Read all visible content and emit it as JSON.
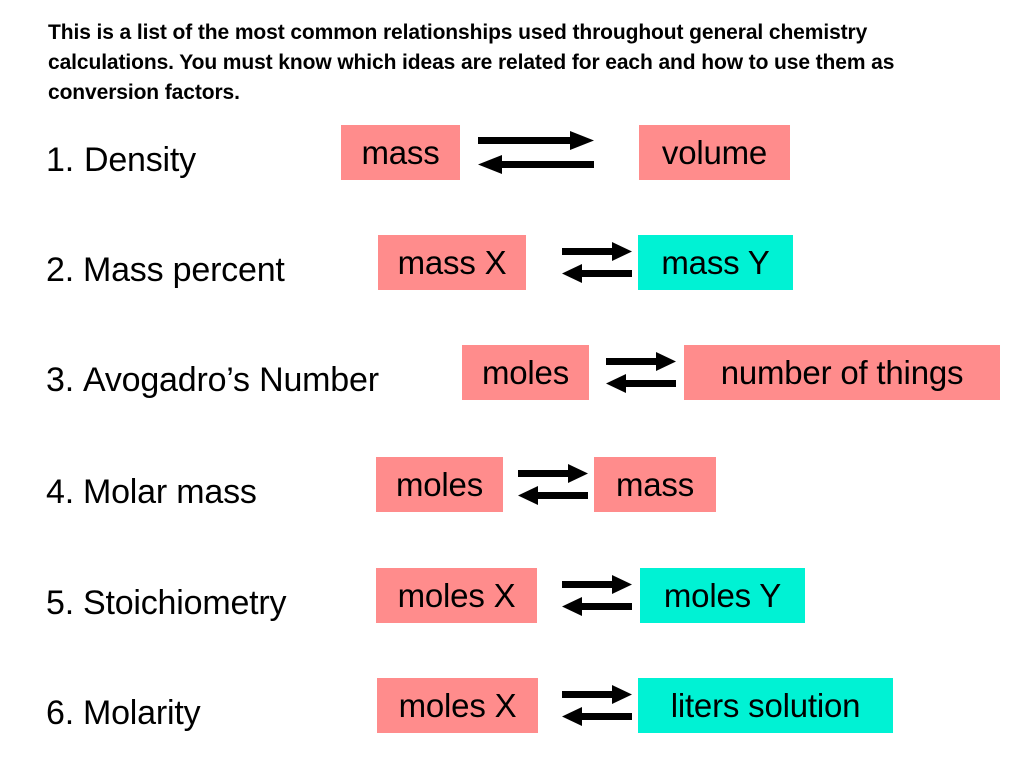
{
  "intro": {
    "text": "This is a list of the most common relationships used throughout general chemistry calculations. You must know which ideas are related for each and how to use them as conversion factors."
  },
  "colors": {
    "pink": "#ff8c8c",
    "cyan": "#00f2d4",
    "text": "#000000",
    "background": "#ffffff"
  },
  "arrow_icon": "double-headed-equilibrium-arrows",
  "rows": [
    {
      "number": "1.",
      "label": "Density",
      "left_box": {
        "text": "mass",
        "color": "pink"
      },
      "right_box": {
        "text": "volume",
        "color": "pink"
      },
      "arrow_style": "long"
    },
    {
      "number": "2.",
      "label": "Mass percent",
      "left_box": {
        "text": "mass X",
        "color": "pink"
      },
      "right_box": {
        "text": "mass Y",
        "color": "cyan"
      },
      "arrow_style": "short"
    },
    {
      "number": "3.",
      "label": "Avogadro’s Number",
      "left_box": {
        "text": "moles",
        "color": "pink"
      },
      "right_box": {
        "text": "number of things",
        "color": "pink"
      },
      "arrow_style": "short"
    },
    {
      "number": "4.",
      "label": "Molar mass",
      "left_box": {
        "text": "moles",
        "color": "pink"
      },
      "right_box": {
        "text": "mass",
        "color": "pink"
      },
      "arrow_style": "short"
    },
    {
      "number": "5.",
      "label": "Stoichiometry",
      "left_box": {
        "text": "moles X",
        "color": "pink"
      },
      "right_box": {
        "text": "moles Y",
        "color": "cyan"
      },
      "arrow_style": "short"
    },
    {
      "number": "6.",
      "label": "Molarity",
      "left_box": {
        "text": "moles X",
        "color": "pink"
      },
      "right_box": {
        "text": "liters solution",
        "color": "cyan"
      },
      "arrow_style": "short"
    }
  ]
}
